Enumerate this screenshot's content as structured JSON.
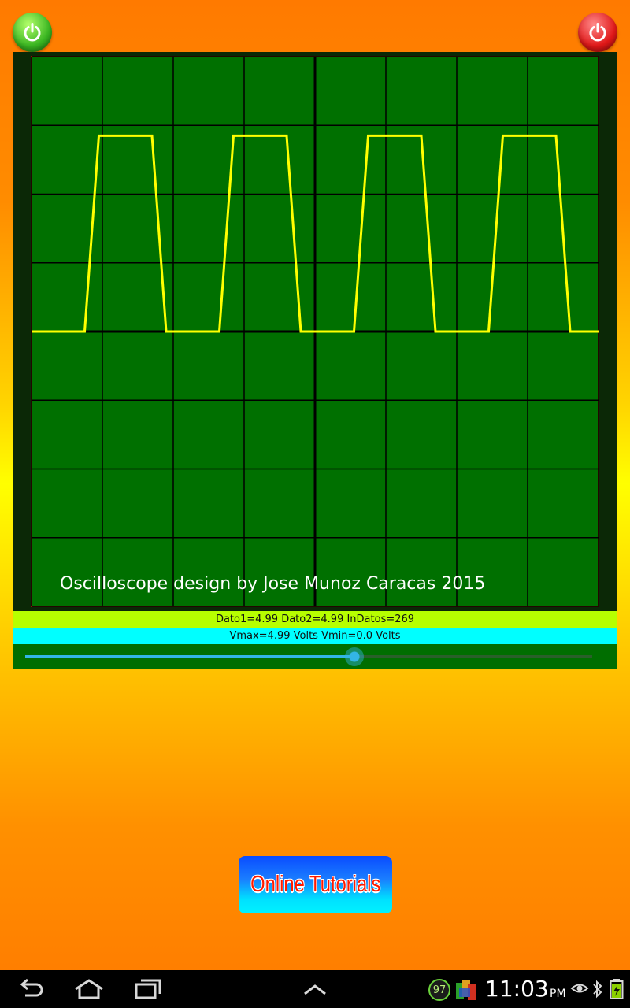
{
  "scope": {
    "caption": "Oscilloscope design by Jose Munoz Caracas 2015",
    "colors": {
      "screen": "#007000",
      "grid": "#000000",
      "border": "#8a1a00",
      "trace": "#ffff00"
    }
  },
  "chart_data": {
    "type": "line",
    "series": [
      {
        "x": [
          0,
          0.75,
          0.95,
          1.7,
          1.9,
          2.65,
          2.85,
          3.6,
          3.8,
          4.55,
          4.75,
          5.5,
          5.7,
          6.45,
          6.65,
          7.4,
          7.6,
          8.4
        ],
        "values": [
          0,
          0,
          2.85,
          2.85,
          0,
          0,
          2.85,
          2.85,
          0,
          0,
          2.85,
          2.85,
          0,
          0,
          2.85,
          2.85,
          0,
          0
        ]
      }
    ],
    "xlim": [
      0,
      8
    ],
    "ylim": [
      -4,
      4
    ],
    "grid": true
  },
  "readouts": {
    "dato": "Dato1=4.99 Dato2=4.99 InDatos=269",
    "vrange": "Vmax=4.99 Volts Vmin=0.0 Volts"
  },
  "slider": {
    "value_fraction": 0.58,
    "color": "#33b5e5"
  },
  "buttons": {
    "tutorials_label": "Online Tutorials",
    "power_on_icon": "power-on-icon",
    "power_off_icon": "power-off-icon"
  },
  "status_bar": {
    "notification_count": "97",
    "time": "11:03",
    "ampm": "PM"
  }
}
